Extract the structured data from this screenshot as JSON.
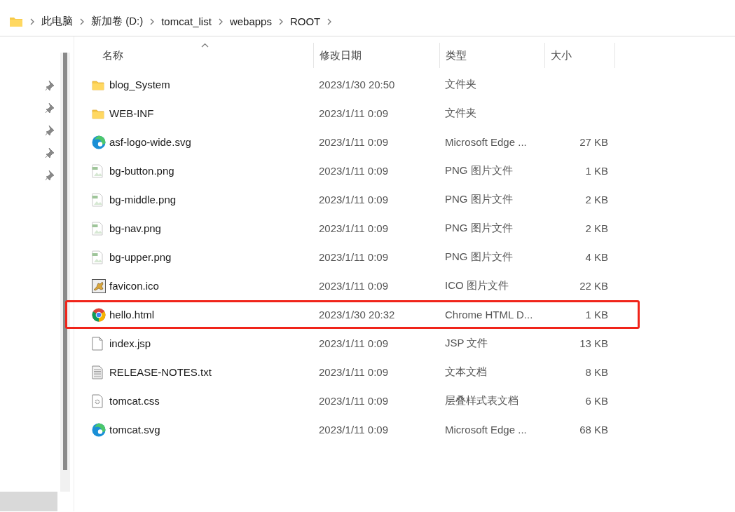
{
  "breadcrumb": [
    "此电脑",
    "新加卷 (D:)",
    "tomcat_list",
    "webapps",
    "ROOT"
  ],
  "columns": [
    {
      "label": "名称",
      "sorted": true
    },
    {
      "label": "修改日期",
      "sorted": false
    },
    {
      "label": "类型",
      "sorted": false
    },
    {
      "label": "大小",
      "sorted": false
    }
  ],
  "files": [
    {
      "kind": "folder",
      "name": "blog_System",
      "modified": "2023/1/30 20:50",
      "type": "文件夹",
      "highlighted": false
    },
    {
      "kind": "folder",
      "name": "WEB-INF",
      "modified": "2023/1/11 0:09",
      "type": "文件夹",
      "highlighted": false
    },
    {
      "kind": "edge",
      "name": "asf-logo-wide.svg",
      "modified": "2023/1/11 0:09",
      "type": "Microsoft Edge ...",
      "size": "27 KB",
      "highlighted": false
    },
    {
      "kind": "png",
      "name": "bg-button.png",
      "modified": "2023/1/11 0:09",
      "type": "PNG 图片文件",
      "size": "1 KB",
      "highlighted": false
    },
    {
      "kind": "png",
      "name": "bg-middle.png",
      "modified": "2023/1/11 0:09",
      "type": "PNG 图片文件",
      "size": "2 KB",
      "highlighted": false
    },
    {
      "kind": "png",
      "name": "bg-nav.png",
      "modified": "2023/1/11 0:09",
      "type": "PNG 图片文件",
      "size": "2 KB",
      "highlighted": false
    },
    {
      "kind": "png",
      "name": "bg-upper.png",
      "modified": "2023/1/11 0:09",
      "type": "PNG 图片文件",
      "size": "4 KB",
      "highlighted": false
    },
    {
      "kind": "cat",
      "name": "favicon.ico",
      "modified": "2023/1/11 0:09",
      "type": "ICO 图片文件",
      "size": "22 KB",
      "highlighted": false
    },
    {
      "kind": "chrome",
      "name": "hello.html",
      "modified": "2023/1/30 20:32",
      "type": "Chrome HTML D...",
      "size": "1 KB",
      "highlighted": true
    },
    {
      "kind": "file",
      "name": "index.jsp",
      "modified": "2023/1/11 0:09",
      "type": "JSP 文件",
      "size": "13 KB",
      "highlighted": false
    },
    {
      "kind": "text",
      "name": "RELEASE-NOTES.txt",
      "modified": "2023/1/11 0:09",
      "type": "文本文档",
      "size": "8 KB",
      "highlighted": false
    },
    {
      "kind": "css",
      "name": "tomcat.css",
      "modified": "2023/1/11 0:09",
      "type": "层叠样式表文档",
      "size": "6 KB",
      "highlighted": false
    },
    {
      "kind": "edge",
      "name": "tomcat.svg",
      "modified": "2023/1/11 0:09",
      "type": "Microsoft Edge ...",
      "size": "68 KB",
      "highlighted": false
    }
  ]
}
